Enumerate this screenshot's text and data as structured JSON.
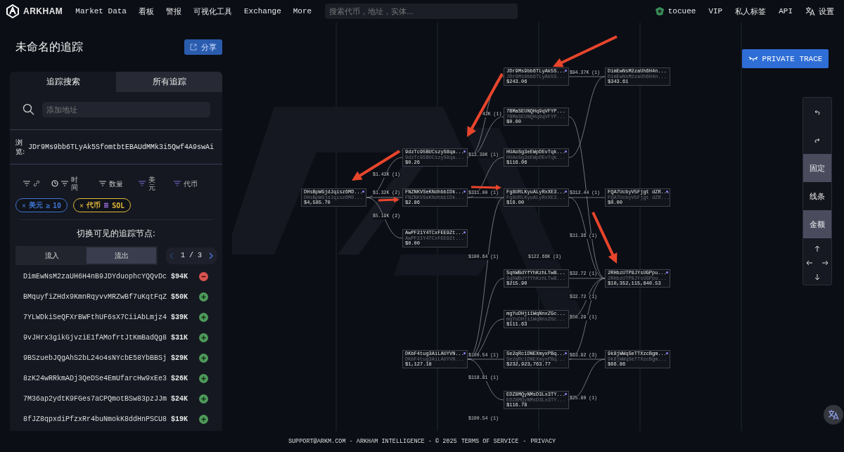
{
  "nav": {
    "logo": "ARKHAM",
    "items": [
      "Market Data",
      "看板",
      "警报",
      "可视化工具",
      "Exchange",
      "More"
    ],
    "search": {
      "placeholder": "搜索代币，地址，实体..."
    },
    "user": "tocuee",
    "right_items": [
      "VIP",
      "私人标签",
      "API"
    ],
    "settings": "设置"
  },
  "trace": {
    "title": "未命名的追踪",
    "share": "分享",
    "tabs": [
      {
        "label": "追踪搜索",
        "selected": true
      },
      {
        "label": "所有追踪",
        "selected": false
      }
    ],
    "add_field": {
      "placeholder": "添加地址"
    },
    "browse": {
      "label": "浏览:",
      "address": "JDr9Ms9bb6TLyAk5SfomtbtEBAUdMMk3i5Qwf4A9swAi"
    },
    "filters": [
      {
        "kind": "link",
        "active": false
      },
      {
        "kind": "time",
        "label": "时间",
        "active": false
      },
      {
        "kind": "plain",
        "label": "数量",
        "active": false
      },
      {
        "kind": "plain",
        "label": "美元",
        "active": true
      },
      {
        "kind": "plain",
        "label": "代币",
        "active": true
      }
    ],
    "chips": [
      {
        "kind": "usd",
        "remove": "×",
        "field": "美元",
        "op": "≥",
        "value": "10",
        "color": "#3f74d0"
      },
      {
        "kind": "token",
        "remove": "×",
        "field": "代币",
        "value": "SOL",
        "color": "#e0b83a"
      }
    ],
    "nodes_title": "切换可见的追踪节点:",
    "direction_tabs": [
      {
        "label": "流入",
        "selected": false
      },
      {
        "label": "流出",
        "selected": true
      }
    ],
    "pager": "1 / 3",
    "addresses": [
      {
        "address": "DimEwNsM2zaUH6H4nB9JDYduophcYQQvDc",
        "amount": "$94K",
        "included": true
      },
      {
        "address": "BMquyfiZHdx9KmnRqyvvMRZwBf7uKqtFqZ",
        "amount": "$50K",
        "included": false
      },
      {
        "address": "7YLWDkiSeQFXrBWFthUF6sX7CiiAbLmjz4",
        "amount": "$39K",
        "included": false
      },
      {
        "address": "9vJHrx3gikGjvziE1fAMofrtJtKmBadQg8",
        "amount": "$31K",
        "included": false
      },
      {
        "address": "9BSzuebJQgAhS2bL24o4sNYcbE58YbBBSj",
        "amount": "$29K",
        "included": false
      },
      {
        "address": "8zK24wRRkmADj3QeDSe4EmUfarcHw9xEe3",
        "amount": "$26K",
        "included": false
      },
      {
        "address": "7M36ap2ydtK9FGes7aCPQmotBSw83pzJJm",
        "amount": "$24K",
        "included": false
      },
      {
        "address": "8fJZ8qpxdiPfzxRr4buNmokK8ddHnPSCU8",
        "amount": "$19K",
        "included": false
      }
    ]
  },
  "graph": {
    "private_button": "PRIVATE TRACE",
    "nodes": [
      {
        "address": "JDr9Ms9bb6TLyAk5S...",
        "subtitle": "JDr9Ms9bb6TLyAk5S...",
        "balance": "$243.06",
        "marked": true
      },
      {
        "address": "DimEwNsM2zaUh6H4n...",
        "subtitle": "DimEwNsM2zaUh6H4n...",
        "balance": "$343.61",
        "marked": false
      },
      {
        "address": "7BMaSEUNQHq9qVFYP...",
        "subtitle": "7BMaSEUNQHq9qVFYP...",
        "balance": "$0.00",
        "marked": false
      },
      {
        "address": "9dzTc95BUCszyS8qa...",
        "subtitle": "9dzTc95BUCszyS8qa...",
        "balance": "$0.26",
        "marked": true
      },
      {
        "address": "HUAoSg3eEWpDEvTqk...",
        "subtitle": "HUAoSg3eEWpDEvTqk...",
        "balance": "$116.06",
        "marked": true
      },
      {
        "address": "DHsBpWGjdJqisz6MD...",
        "subtitle": "DHsBpWGjdJqisz6MD...",
        "balance": "$4,585.70",
        "marked": true
      },
      {
        "address": "FNZNKVSeKNdhbbIDk...",
        "subtitle": "FNZNKVSeKNdhbbIDk...",
        "balance": "$2.86",
        "marked": true
      },
      {
        "address": "Fg8URLKyuALyRxXE3...",
        "subtitle": "Fg8URLKyuALyRxXE3...",
        "balance": "$16.00",
        "marked": true
      },
      {
        "address": "FQA7UcbyV5Fjgt dZR...",
        "subtitle": "FQA7UcbyV5Fjgt dZR...",
        "balance": "$0.00",
        "marked": true
      },
      {
        "address": "AwPF21Y4TCxFEE9Zt...",
        "subtitle": "AwPF21Y4TCxFEE9Zt...",
        "balance": "$0.00",
        "marked": true
      },
      {
        "address": "SqhWBdYfYhKzhLTwB...",
        "subtitle": "SqhWBdYfYhKzhLTwB...",
        "balance": "$215.90",
        "marked": false
      },
      {
        "address": "2RHbzUTP8JYsUGPpu...",
        "subtitle": "2RHbzUTP8JYsUGPpu...",
        "balance": "$10,352,115,840.53",
        "marked": true
      },
      {
        "address": "mgYuDHji1WqNnxZGc...",
        "subtitle": "mgYuDHji1WqNnxZGc...",
        "balance": "$111.63",
        "marked": false
      },
      {
        "address": "DKbF4tug3AiLAUYVN...",
        "subtitle": "DKbF4tug3AiLAUYVN...",
        "balance": "$1,127.18",
        "marked": true
      },
      {
        "address": "Se2qRc1DNEXmyxPBq...",
        "subtitle": "Se2qRc1DNEXmyxPBq...",
        "balance": "$232,923,763.77",
        "marked": true
      },
      {
        "address": "9k8jWWqSeTTXzcBgm...",
        "subtitle": "9k8jWWqSeTTXzcBgm...",
        "balance": "$66.86",
        "marked": true
      },
      {
        "address": "EDZ8MQyNMsD3Lx3TY...",
        "subtitle": "EDZ8MQyNMsD3Lx3TY...",
        "balance": "$116.78",
        "marked": true
      }
    ],
    "edge_labels": [
      "$94.37K (1)",
      "42K (1)",
      "$13.38K (1)",
      "$1.43K (1)",
      "$1.32K (2)",
      "$5.19K (2)",
      "$331.00 (1)",
      "$312.44 (1)",
      "$11.36 (1)",
      "$100.64 (1)",
      "$122.66K (3)",
      "$32.72 (1)",
      "$32.72 (1)",
      "$50.29 (1)",
      "$100.54 (1)",
      "$63.92 (3)",
      "$118.81 (1)",
      "$25.80 (1)",
      "$100.54 (1)"
    ],
    "toggles": [
      {
        "label": "固定",
        "on": true
      },
      {
        "label": "线条",
        "on": false
      },
      {
        "label": "金额",
        "on": true
      }
    ]
  },
  "footer": {
    "text": "SUPPORT@ARKM.COM - ARKHAM INTELLIGENCE - © 2025",
    "links": [
      "TERMS OF SERVICE",
      "PRIVACY"
    ],
    "separator": "-"
  }
}
